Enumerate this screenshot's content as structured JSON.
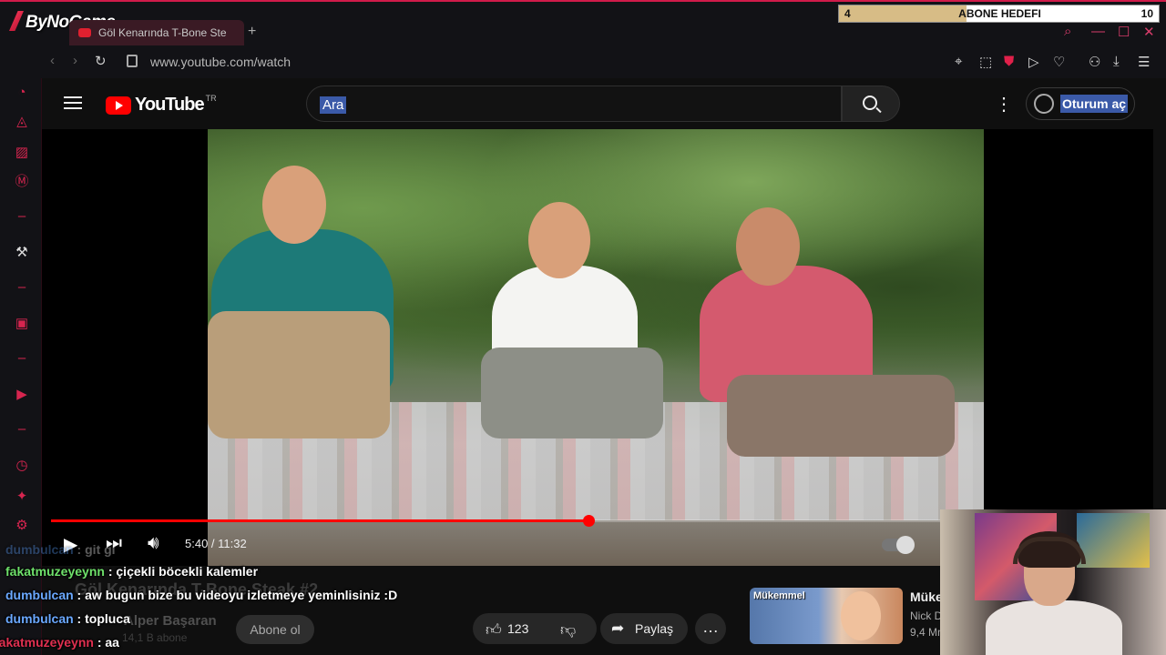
{
  "browser": {
    "brand": "ByNoGame",
    "tab_title": "Göl Kenarında T-Bone Ste",
    "new_tab": "+",
    "url": "www.youtube.com/watch"
  },
  "youtube": {
    "logo_text": "YouTube",
    "country": "TR",
    "search_placeholder": "Ara",
    "sign_in": "Oturum aç"
  },
  "player": {
    "current_time": "5:40",
    "duration": "11:32",
    "time_display": "5:40 / 11:32",
    "progress_fraction": 0.4913
  },
  "video_info": {
    "title": "Göl Kenarında T-Bone Steak #2",
    "channel": "Alper Başaran",
    "subscribers": "14,1 B abone",
    "subscribe": "Abone ol",
    "likes": "123",
    "share": "Paylaş",
    "more": "…"
  },
  "recommended": {
    "thumb_caption": "Mükemmel",
    "title": "Müke",
    "channel": "Nick D",
    "views": "9,4 Mn"
  },
  "stream_goal": {
    "current": "4",
    "label": "ABONE HEDEFI",
    "target": "10",
    "progress_fraction": 0.4
  },
  "chat": [
    {
      "user": "dumbulcan",
      "text": "git gl",
      "color": "#5aa0ff",
      "faded": true
    },
    {
      "user": "fakatmuzeyeynn",
      "text": "çiçekli böcekli kalemler",
      "color": "#6ee06a"
    },
    {
      "user": "dumbulcan",
      "text": "aw bugun bize bu videoyu izletmeye yeminlisiniz :D",
      "color": "#6aa8ff"
    },
    {
      "user": "dumbulcan",
      "text": "topluca",
      "color": "#6aa8ff"
    },
    {
      "user": "fakatmuzeyeynn",
      "text": "aa",
      "color": "#e03050"
    }
  ],
  "colors": {
    "accent": "#d11b4a",
    "yt_red": "#ff0000",
    "selection": "#3b5aa8"
  }
}
